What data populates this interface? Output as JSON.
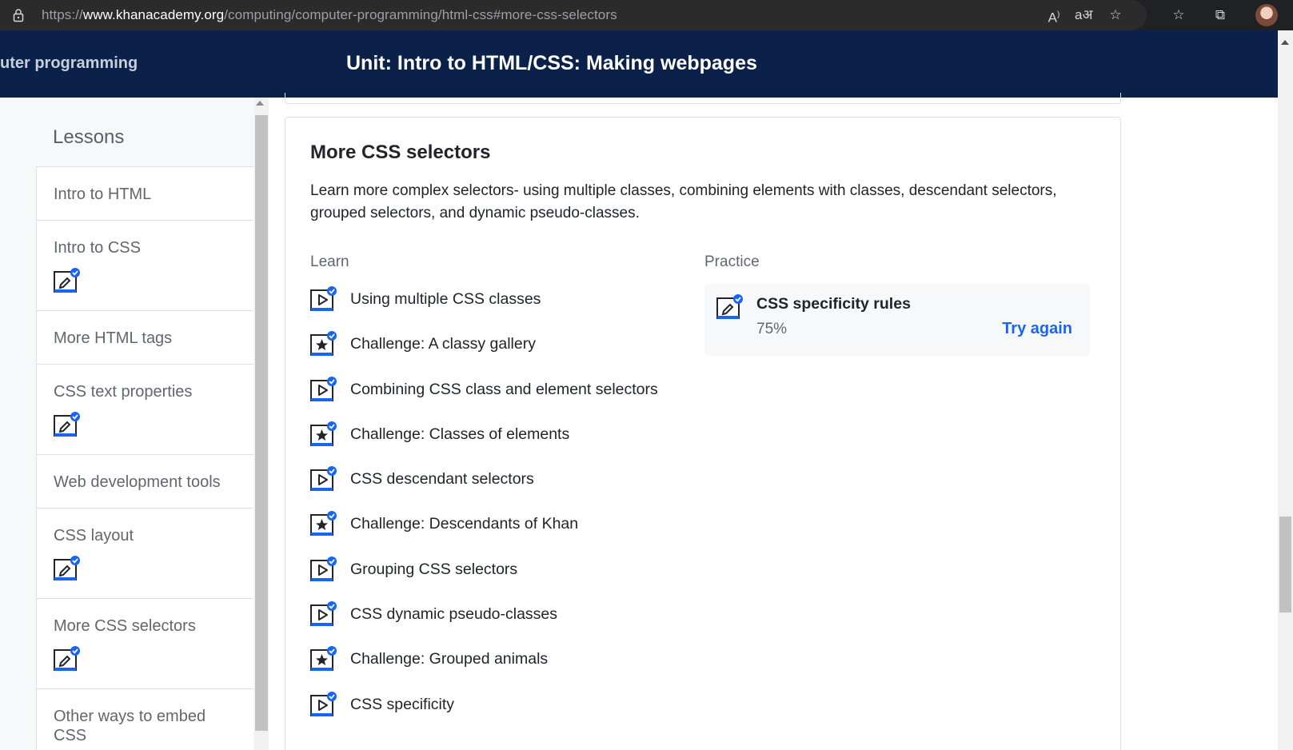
{
  "browser": {
    "url_scheme": "https://",
    "url_host": "www.khanacademy.org",
    "url_path": "/computing/computer-programming/html-css#more-css-selectors"
  },
  "header": {
    "breadcrumb": "uter programming",
    "unit_title": "Unit: Intro to HTML/CSS: Making webpages"
  },
  "sidebar": {
    "title": "Lessons",
    "lessons": [
      {
        "label": "Intro to HTML",
        "has_icon": false
      },
      {
        "label": "Intro to CSS",
        "has_icon": true
      },
      {
        "label": "More HTML tags",
        "has_icon": false
      },
      {
        "label": "CSS text properties",
        "has_icon": true
      },
      {
        "label": "Web development tools",
        "has_icon": false
      },
      {
        "label": "CSS layout",
        "has_icon": true
      },
      {
        "label": "More CSS selectors",
        "has_icon": true
      },
      {
        "label": "Other ways to embed CSS",
        "has_icon": false
      }
    ]
  },
  "lesson": {
    "title": "More CSS selectors",
    "description": "Learn more complex selectors- using multiple classes, combining elements with classes, descendant selectors, grouped selectors, and dynamic pseudo-classes.",
    "learn_heading": "Learn",
    "practice_heading": "Practice",
    "learn_items": [
      {
        "label": "Using multiple CSS classes",
        "kind": "video-icon"
      },
      {
        "label": "Challenge: A classy gallery",
        "kind": "star-icon"
      },
      {
        "label": "Combining CSS class and element selectors",
        "kind": "video-icon"
      },
      {
        "label": "Challenge: Classes of elements",
        "kind": "star-icon"
      },
      {
        "label": "CSS descendant selectors",
        "kind": "video-icon"
      },
      {
        "label": "Challenge: Descendants of Khan",
        "kind": "star-icon"
      },
      {
        "label": "Grouping CSS selectors",
        "kind": "video-icon"
      },
      {
        "label": "CSS dynamic pseudo-classes",
        "kind": "video-icon"
      },
      {
        "label": "Challenge: Grouped animals",
        "kind": "star-icon"
      },
      {
        "label": "CSS specificity",
        "kind": "video-icon"
      }
    ],
    "practice": {
      "title": "CSS specificity rules",
      "score": "75%",
      "action": "Try again"
    }
  },
  "colors": {
    "header_bg": "#0b2149",
    "accent_blue": "#1865f2",
    "sidebar_bg": "#f7f8fa"
  }
}
